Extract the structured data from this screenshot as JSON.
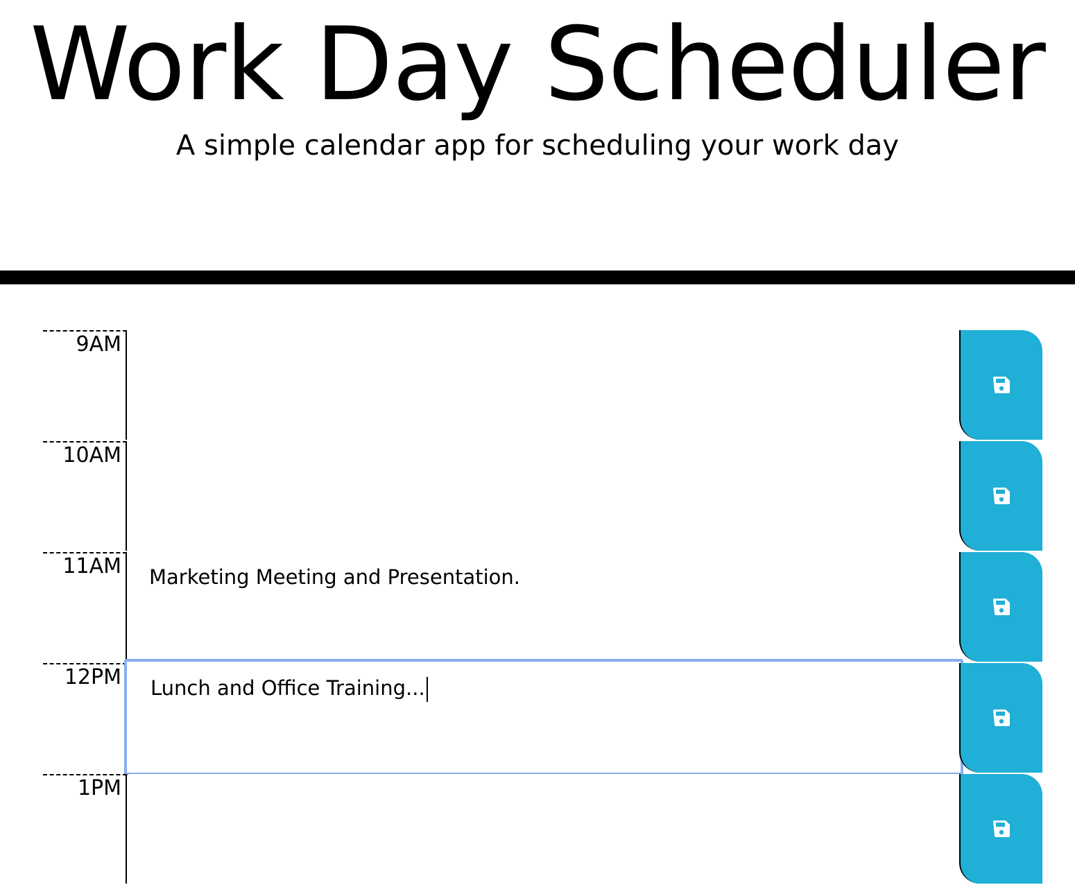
{
  "header": {
    "title": "Work Day Scheduler",
    "subtitle": "A simple calendar app for scheduling your work day"
  },
  "schedule": {
    "rows": [
      {
        "hour": "9AM",
        "text": ""
      },
      {
        "hour": "10AM",
        "text": ""
      },
      {
        "hour": "11AM",
        "text": "Marketing Meeting and Presentation."
      },
      {
        "hour": "12PM",
        "text": "Lunch and Office Training..."
      },
      {
        "hour": "1PM",
        "text": ""
      }
    ],
    "focused_row": 3
  },
  "colors": {
    "save_button": "#20afd6",
    "focus_ring": "#86aef0",
    "divider": "#000000"
  },
  "icons": {
    "save": "floppy-disk-icon"
  }
}
